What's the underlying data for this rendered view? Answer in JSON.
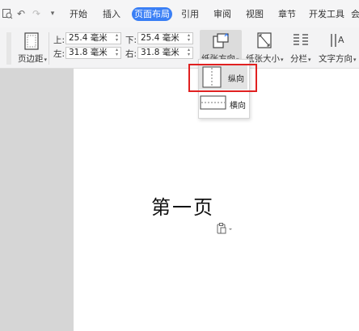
{
  "tabs": [
    {
      "label": "开始"
    },
    {
      "label": "插入"
    },
    {
      "label": "页面布局"
    },
    {
      "label": "引用"
    },
    {
      "label": "审阅"
    },
    {
      "label": "视图"
    },
    {
      "label": "章节"
    },
    {
      "label": "开发工具"
    },
    {
      "label": "会"
    }
  ],
  "ribbon": {
    "margins_label": "页边距",
    "top_label": "上:",
    "top_value": "25.4 毫米",
    "bottom_label": "下:",
    "bottom_value": "25.4 毫米",
    "left_label": "左:",
    "left_value": "31.8 毫米",
    "right_label": "右:",
    "right_value": "31.8 毫米",
    "orientation_label": "纸张方向",
    "size_label": "纸张大小",
    "columns_label": "分栏",
    "text_direction_label": "文字方向"
  },
  "orientation_menu": {
    "portrait_label": "纵向",
    "landscape_label": "横向"
  },
  "document": {
    "heading": "第一页"
  },
  "colors": {
    "active_tab": "#3a7ff5",
    "highlight_box": "#e02020"
  }
}
